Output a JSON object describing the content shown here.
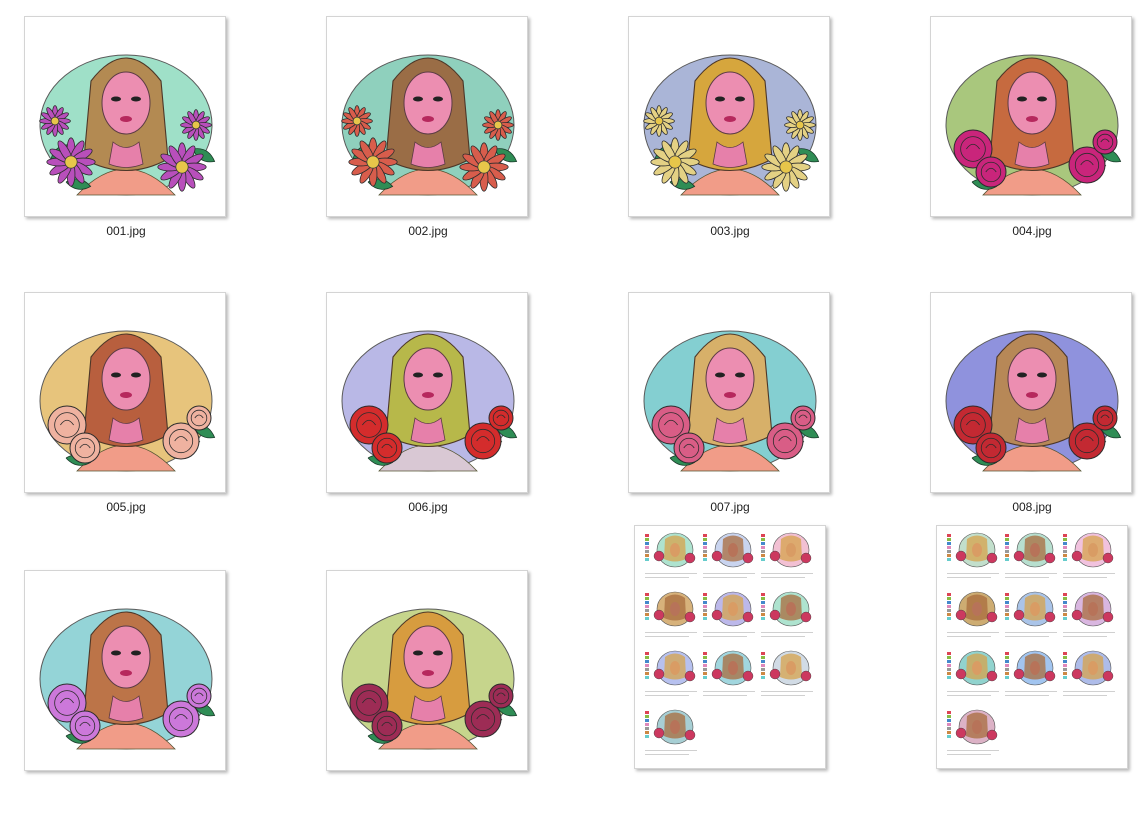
{
  "files": [
    {
      "name": "001.jpg",
      "bg": "#9fe0c8",
      "hair": "#b38a52",
      "flower": "#b84fbb",
      "flowerKind": "daisy",
      "kind": "portrait"
    },
    {
      "name": "002.jpg",
      "bg": "#8fd0bd",
      "hair": "#9a6d46",
      "flower": "#d85d4c",
      "flowerKind": "daisy",
      "kind": "portrait"
    },
    {
      "name": "003.jpg",
      "bg": "#aab5d7",
      "hair": "#d6a63d",
      "flower": "#e4d184",
      "flowerKind": "daisy",
      "kind": "portrait"
    },
    {
      "name": "004.jpg",
      "bg": "#a9c77d",
      "hair": "#c66a3f",
      "flower": "#c9257b",
      "flowerKind": "rose",
      "kind": "portrait"
    },
    {
      "name": "005.jpg",
      "bg": "#e7c47c",
      "hair": "#b85f3e",
      "flower": "#efb2a0",
      "flowerKind": "rose",
      "kind": "portrait"
    },
    {
      "name": "006.jpg",
      "bg": "#b9b8e6",
      "hair": "#b7b84a",
      "flower": "#d42c2c",
      "flowerKind": "rose",
      "kind": "portrait"
    },
    {
      "name": "007.jpg",
      "bg": "#84cfd1",
      "hair": "#d7b069",
      "flower": "#d95d86",
      "flowerKind": "rose",
      "kind": "portrait"
    },
    {
      "name": "008.jpg",
      "bg": "#8f92dd",
      "hair": "#b78857",
      "flower": "#c32932",
      "flowerKind": "rose",
      "kind": "portrait"
    },
    {
      "name": "",
      "bg": "#94d4d7",
      "hair": "#bc7448",
      "flower": "#cc78da",
      "flowerKind": "rose",
      "kind": "portrait"
    },
    {
      "name": "",
      "bg": "#c6d58c",
      "hair": "#d79c3f",
      "flower": "#9d2c55",
      "flowerKind": "rose",
      "kind": "portrait"
    },
    {
      "name": "",
      "kind": "sheet",
      "sheetBgs": [
        "#aee3cf",
        "#c9d4ef",
        "#f2c0d3",
        "#d7b27b",
        "#bcb8ea",
        "#aee3cf",
        "#b7c1ef",
        "#a1d6de",
        "#d1dbe5",
        "#a7cfd4"
      ]
    },
    {
      "name": "",
      "kind": "sheet",
      "sheetBgs": [
        "#c2dfcc",
        "#b7dfcf",
        "#f1c2de",
        "#cdac72",
        "#aac4e8",
        "#d9b6e0",
        "#91d3ce",
        "#a2c5f0",
        "#aebce9",
        "#dcb2c6"
      ]
    }
  ]
}
